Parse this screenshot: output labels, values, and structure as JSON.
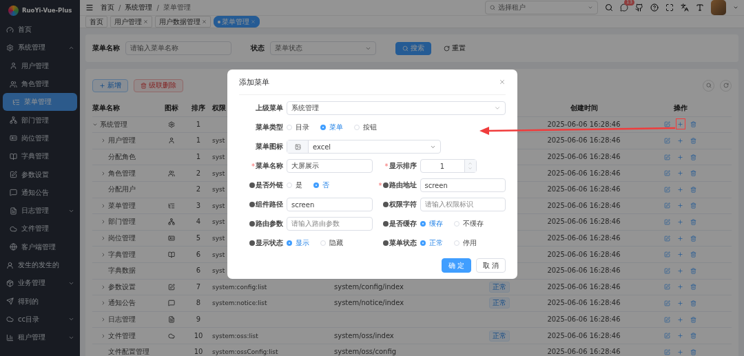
{
  "sidebar": {
    "logo": "RuoYi-Vue-Plus",
    "items": [
      {
        "label": "首页",
        "selected": false
      },
      {
        "label": "系统管理",
        "selected": false,
        "expanded": true,
        "children": [
          {
            "label": "用户管理",
            "selected": false
          },
          {
            "label": "角色管理",
            "selected": false
          },
          {
            "label": "菜单管理",
            "selected": true
          },
          {
            "label": "部门管理",
            "selected": false
          },
          {
            "label": "岗位管理",
            "selected": false
          },
          {
            "label": "字典管理",
            "selected": false
          },
          {
            "label": "参数设置",
            "selected": false
          },
          {
            "label": "通知公告",
            "selected": false
          },
          {
            "label": "日志管理",
            "selected": false,
            "expanded": false
          },
          {
            "label": "文件管理",
            "selected": false
          },
          {
            "label": "客户端管理",
            "selected": false
          }
        ]
      },
      {
        "label": "发生的发生的",
        "selected": false
      },
      {
        "label": "业务管理",
        "selected": false,
        "expanded": false
      },
      {
        "label": "得到的",
        "selected": false
      },
      {
        "label": "cc目录",
        "selected": false,
        "expanded": false
      },
      {
        "label": "租户管理",
        "selected": false,
        "expanded": false
      }
    ]
  },
  "breadcrumb": {
    "separator": "/",
    "items": [
      "首页",
      "系统管理",
      "菜单管理"
    ]
  },
  "header": {
    "tenant_placeholder": "选择租户",
    "message_badge": "13"
  },
  "tabs": [
    {
      "label": "首页",
      "selected": false,
      "closable": false
    },
    {
      "label": "用户管理",
      "selected": false,
      "closable": true
    },
    {
      "label": "用户数据管理",
      "selected": false,
      "closable": true
    },
    {
      "label": "菜单管理",
      "selected": true,
      "closable": true
    }
  ],
  "search": {
    "name_label": "菜单名称",
    "name_placeholder": "请输入菜单名称",
    "status_label": "状态",
    "status_placeholder": "菜单状态",
    "search_button": "搜索",
    "reset_button": "重置"
  },
  "toolbar": {
    "add_button": "新增",
    "delete_button": "级联删除"
  },
  "table": {
    "columns": [
      "菜单名称",
      "图标",
      "排序",
      "权限",
      "",
      "",
      "创建时间",
      "操作"
    ],
    "rows": [
      {
        "name": "系统管理",
        "kind": "branch",
        "expanded": true,
        "order": "1",
        "created": "2025-06-06 16:28:46",
        "children": [
          {
            "name": "用户管理",
            "kind": "branch",
            "expanded": false,
            "order": "1",
            "perm": "syst",
            "created": "2025-06-06 16:28:46"
          },
          {
            "name": "分配角色",
            "kind": "leaf",
            "order": "1",
            "perm": "syst",
            "created": "2025-06-06 16:28:46"
          },
          {
            "name": "角色管理",
            "kind": "branch",
            "expanded": false,
            "order": "2",
            "perm": "syst",
            "created": "2025-06-06 16:28:46"
          },
          {
            "name": "分配用户",
            "kind": "leaf",
            "order": "2",
            "perm": "syst",
            "created": "2025-06-06 16:28:46"
          },
          {
            "name": "菜单管理",
            "kind": "branch",
            "expanded": false,
            "order": "3",
            "perm": "syst",
            "created": "2025-06-06 16:28:46"
          },
          {
            "name": "部门管理",
            "kind": "branch",
            "expanded": false,
            "order": "4",
            "perm": "syst",
            "created": "2025-06-06 16:28:46"
          },
          {
            "name": "岗位管理",
            "kind": "branch",
            "expanded": false,
            "order": "5",
            "perm": "syst",
            "created": "2025-06-06 16:28:46"
          },
          {
            "name": "字典管理",
            "kind": "branch",
            "expanded": false,
            "order": "6",
            "perm": "syst",
            "created": "2025-06-06 16:28:46"
          },
          {
            "name": "字典数据",
            "kind": "leaf",
            "order": "6",
            "perm": "syst",
            "created": "2025-06-06 16:28:46"
          },
          {
            "name": "参数设置",
            "kind": "branch",
            "expanded": false,
            "order": "7",
            "perm": "system:config:list",
            "path": "system/config/index",
            "status": "正常",
            "created": "2025-06-06 16:28:46"
          },
          {
            "name": "通知公告",
            "kind": "branch",
            "expanded": false,
            "order": "8",
            "perm": "system:notice:list",
            "path": "system/notice/index",
            "status": "正常",
            "created": "2025-06-06 16:28:46"
          },
          {
            "name": "日志管理",
            "kind": "branch",
            "expanded": false,
            "order": "9",
            "created": "2025-06-06 16:28:46"
          },
          {
            "name": "文件管理",
            "kind": "branch",
            "expanded": false,
            "order": "10",
            "perm": "system:oss:list",
            "path": "system/oss/index",
            "status": "正常",
            "created": "2025-06-06 16:28:46"
          },
          {
            "name": "文件配置管理",
            "kind": "leaf",
            "order": "10",
            "perm": "system:ossConfig:list",
            "path": "system/oss/config",
            "created": "2025-06-06 16:28:46"
          }
        ]
      }
    ]
  },
  "dialog": {
    "title": "添加菜单",
    "rows": [
      {
        "fields": [
          {
            "kind": "select",
            "label": "上级菜单",
            "value": "系统管理"
          }
        ]
      },
      {
        "fields": [
          {
            "kind": "radio",
            "label": "菜单类型",
            "options": [
              {
                "label": "目录",
                "selected": false
              },
              {
                "label": "菜单",
                "selected": true
              },
              {
                "label": "按钮",
                "selected": false
              }
            ]
          }
        ]
      },
      {
        "fields": [
          {
            "kind": "icon_select",
            "label": "菜单图标",
            "value": "excel"
          }
        ]
      },
      {
        "fields": [
          {
            "kind": "input",
            "label": "菜单名称",
            "required_mark": "*",
            "value": "大屏展示"
          },
          {
            "kind": "number",
            "label": "显示排序",
            "required_mark": "*",
            "value": "1"
          }
        ]
      },
      {
        "fields": [
          {
            "kind": "radio",
            "label": "是否外链",
            "help": true,
            "options": [
              {
                "label": "是",
                "selected": false
              },
              {
                "label": "否",
                "selected": true
              }
            ]
          },
          {
            "kind": "input",
            "label": "路由地址",
            "required_mark": "*",
            "help": true,
            "value": "screen"
          }
        ]
      },
      {
        "fields": [
          {
            "kind": "input",
            "label": "组件路径",
            "help": true,
            "value": "screen"
          },
          {
            "kind": "input",
            "label": "权限字符",
            "help": true,
            "placeholder": "请输入权限标识"
          }
        ]
      },
      {
        "fields": [
          {
            "kind": "input",
            "label": "路由参数",
            "help": true,
            "placeholder": "请输入路由参数"
          },
          {
            "kind": "radio",
            "label": "是否缓存",
            "help": true,
            "options": [
              {
                "label": "缓存",
                "selected": true
              },
              {
                "label": "不缓存",
                "selected": false
              }
            ]
          }
        ]
      },
      {
        "fields": [
          {
            "kind": "radio",
            "label": "显示状态",
            "help": true,
            "options": [
              {
                "label": "显示",
                "selected": true
              },
              {
                "label": "隐藏",
                "selected": false
              }
            ]
          },
          {
            "kind": "radio",
            "label": "菜单状态",
            "help": true,
            "options": [
              {
                "label": "正常",
                "selected": true
              },
              {
                "label": "停用",
                "selected": false
              }
            ]
          }
        ]
      }
    ],
    "confirm_button": "确 定",
    "cancel_button": "取 消"
  }
}
